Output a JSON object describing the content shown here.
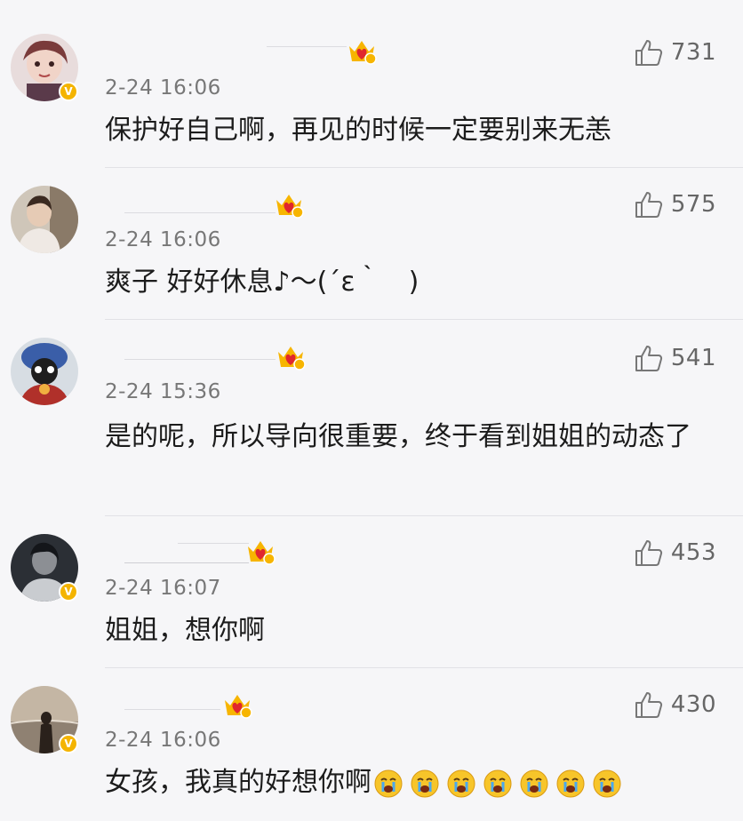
{
  "comments": [
    {
      "time": "2-24 16:06",
      "likes": "731",
      "text": "保护好自己啊，再见的时候一定要别来无恙",
      "avatar_icon": "avatar-illustrated-girl",
      "verified": true
    },
    {
      "time": "2-24 16:06",
      "likes": "575",
      "text": "爽子 好好休息♪～(´ε｀　)",
      "avatar_icon": "avatar-photo-person",
      "verified": false
    },
    {
      "time": "2-24 15:36",
      "likes": "541",
      "text": "是的呢，所以导向很重要，终于看到姐姐的动态了",
      "avatar_icon": "avatar-masked-person",
      "verified": false
    },
    {
      "time": "2-24 16:07",
      "likes": "453",
      "text": "姐姐，想你啊",
      "avatar_icon": "avatar-dark-portrait",
      "verified": true
    },
    {
      "time": "2-24 16:06",
      "likes": "430",
      "text": "女孩，我真的好想你啊",
      "emoji": [
        "crying-face",
        "crying-face",
        "crying-face",
        "crying-face",
        "crying-face",
        "crying-face",
        "crying-face"
      ],
      "avatar_icon": "avatar-beach-silhouette",
      "verified": true
    }
  ],
  "icons": {
    "like": "thumbs-up-icon",
    "vip": "vip-crown-icon",
    "verified": "verified-badge-icon"
  },
  "colors": {
    "background": "#f6f6f8",
    "verified": "#f4b400",
    "vip_crown": "#f7b500",
    "vip_heart": "#e0262e",
    "time": "#777777",
    "likes": "#666666"
  },
  "verified_mark": "V"
}
